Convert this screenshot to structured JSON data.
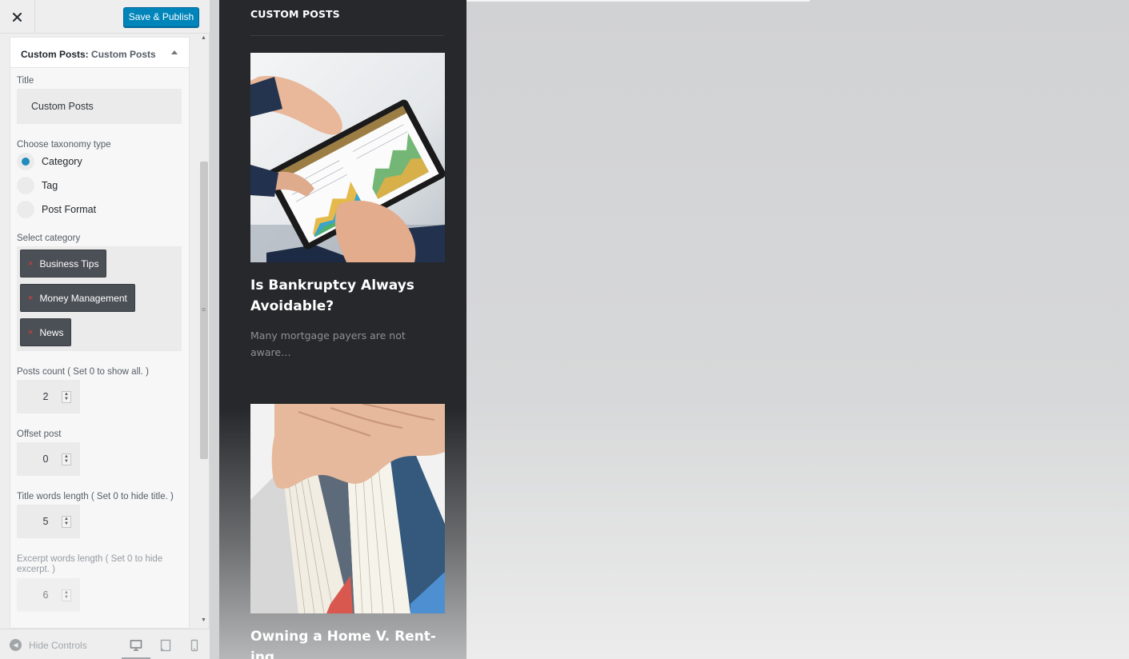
{
  "header": {
    "save_label": "Save & Publish"
  },
  "widget": {
    "heading_prefix": "Custom Posts:",
    "heading_title": "Custom Posts",
    "title_label": "Title",
    "title_value": "Custom Posts",
    "taxonomy_label": "Choose taxonomy type",
    "taxonomy_options": [
      "Category",
      "Tag",
      "Post Format"
    ],
    "taxonomy_selected": "Category",
    "category_label": "Select category",
    "categories": [
      "Business Tips",
      "Money Management",
      "News"
    ],
    "remove_mark": "×",
    "posts_count_label": "Posts count ( Set 0 to show all. )",
    "posts_count": "2",
    "offset_label": "Offset post",
    "offset": "0",
    "title_words_label": "Title words length ( Set 0 to hide title. )",
    "title_words": "5",
    "excerpt_words_label": "Excerpt words length ( Set 0 to hide excerpt. )",
    "excerpt_words": "6"
  },
  "footer": {
    "hide_controls": "Hide Controls"
  },
  "preview": {
    "widget_title": "CUSTOM POSTS",
    "posts": [
      {
        "title": "Is Bankruptcy Always Avoidable?",
        "excerpt": "Many mortgage payers are not aware…"
      },
      {
        "title": "Owning a Home V. Rent-ing",
        "excerpt": ""
      }
    ]
  },
  "colors": {
    "primary_button": "#0085ba",
    "radio_selected": "#1e8cbe",
    "chip_bg": "#4b4f56",
    "chip_remove": "#e03c3c",
    "preview_panel": "#26282b"
  },
  "icons": [
    "close-icon",
    "collapse-arrow-icon",
    "remove-icon",
    "hide-controls-icon",
    "desktop-icon",
    "tablet-icon",
    "mobile-icon"
  ]
}
